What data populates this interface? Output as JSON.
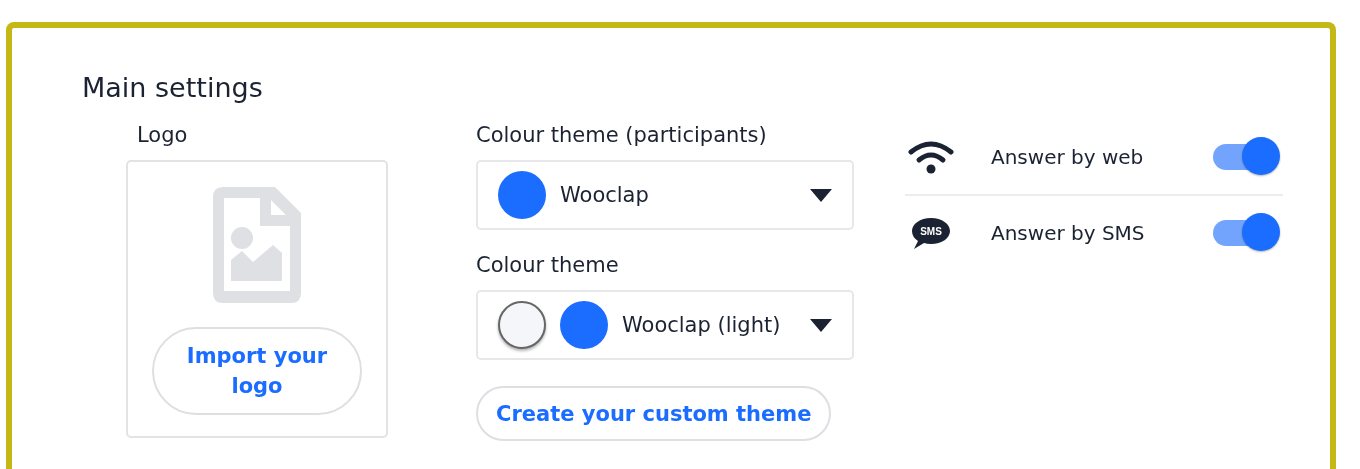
{
  "title": "Main settings",
  "logo": {
    "label": "Logo",
    "button": "Import your logo"
  },
  "themes": [
    {
      "label": "Colour theme (participants)",
      "swatches": [
        {
          "color": "#1a6dff"
        }
      ],
      "value": "Wooclap"
    },
    {
      "label": "Colour theme",
      "swatches": [
        {
          "color": "#f5f6fa"
        },
        {
          "color": "#1a6dff"
        }
      ],
      "value": "Wooclap (light)"
    }
  ],
  "custom_theme_button": "Create your custom theme",
  "options": [
    {
      "kind": "web",
      "label": "Answer by web",
      "on": true
    },
    {
      "kind": "sms",
      "icon_text": "SMS",
      "label": "Answer by SMS",
      "on": true
    }
  ]
}
